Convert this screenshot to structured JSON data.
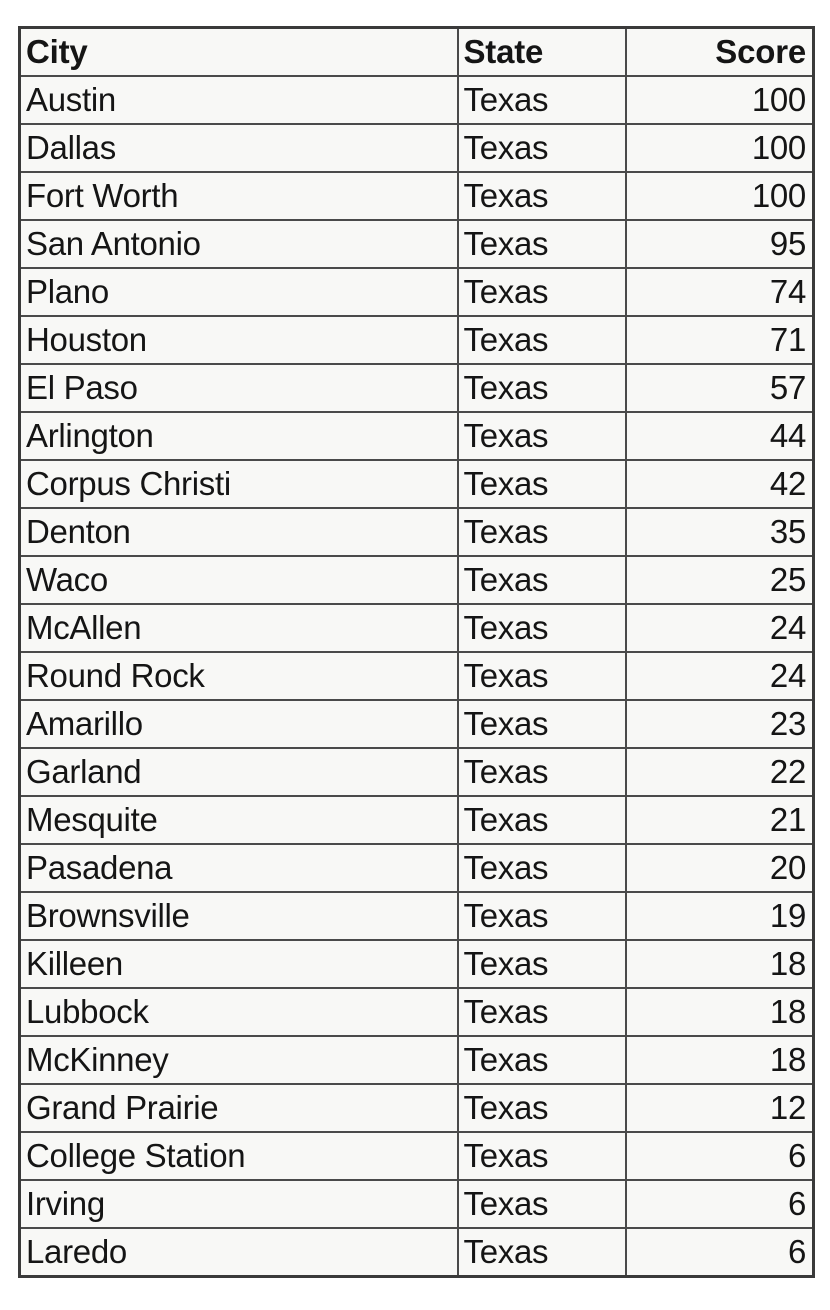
{
  "table": {
    "columns": [
      {
        "key": "city",
        "label": "City",
        "align": "left"
      },
      {
        "key": "state",
        "label": "State",
        "align": "left"
      },
      {
        "key": "score",
        "label": "Score",
        "align": "right"
      }
    ],
    "rows": [
      {
        "city": "Austin",
        "state": "Texas",
        "score": "100"
      },
      {
        "city": "Dallas",
        "state": "Texas",
        "score": "100"
      },
      {
        "city": "Fort Worth",
        "state": "Texas",
        "score": "100"
      },
      {
        "city": "San Antonio",
        "state": "Texas",
        "score": "95"
      },
      {
        "city": "Plano",
        "state": "Texas",
        "score": "74"
      },
      {
        "city": "Houston",
        "state": "Texas",
        "score": "71"
      },
      {
        "city": "El Paso",
        "state": "Texas",
        "score": "57"
      },
      {
        "city": "Arlington",
        "state": "Texas",
        "score": "44"
      },
      {
        "city": "Corpus Christi",
        "state": "Texas",
        "score": "42"
      },
      {
        "city": "Denton",
        "state": "Texas",
        "score": "35"
      },
      {
        "city": "Waco",
        "state": "Texas",
        "score": "25"
      },
      {
        "city": "McAllen",
        "state": "Texas",
        "score": "24"
      },
      {
        "city": "Round Rock",
        "state": "Texas",
        "score": "24"
      },
      {
        "city": "Amarillo",
        "state": "Texas",
        "score": "23"
      },
      {
        "city": "Garland",
        "state": "Texas",
        "score": "22"
      },
      {
        "city": "Mesquite",
        "state": "Texas",
        "score": "21"
      },
      {
        "city": "Pasadena",
        "state": "Texas",
        "score": "20"
      },
      {
        "city": "Brownsville",
        "state": "Texas",
        "score": "19"
      },
      {
        "city": "Killeen",
        "state": "Texas",
        "score": "18"
      },
      {
        "city": "Lubbock",
        "state": "Texas",
        "score": "18"
      },
      {
        "city": "McKinney",
        "state": "Texas",
        "score": "18"
      },
      {
        "city": "Grand Prairie",
        "state": "Texas",
        "score": "12"
      },
      {
        "city": "College Station",
        "state": "Texas",
        "score": "6"
      },
      {
        "city": "Irving",
        "state": "Texas",
        "score": "6"
      },
      {
        "city": "Laredo",
        "state": "Texas",
        "score": "6"
      }
    ]
  },
  "chart_data": {
    "type": "table",
    "title": "",
    "columns": [
      "City",
      "State",
      "Score"
    ],
    "categories": [
      "Austin",
      "Dallas",
      "Fort Worth",
      "San Antonio",
      "Plano",
      "Houston",
      "El Paso",
      "Arlington",
      "Corpus Christi",
      "Denton",
      "Waco",
      "McAllen",
      "Round Rock",
      "Amarillo",
      "Garland",
      "Mesquite",
      "Pasadena",
      "Brownsville",
      "Killeen",
      "Lubbock",
      "McKinney",
      "Grand Prairie",
      "College Station",
      "Irving",
      "Laredo"
    ],
    "values": [
      100,
      100,
      100,
      95,
      74,
      71,
      57,
      44,
      42,
      35,
      25,
      24,
      24,
      23,
      22,
      21,
      20,
      19,
      18,
      18,
      18,
      12,
      6,
      6,
      6
    ],
    "state": [
      "Texas",
      "Texas",
      "Texas",
      "Texas",
      "Texas",
      "Texas",
      "Texas",
      "Texas",
      "Texas",
      "Texas",
      "Texas",
      "Texas",
      "Texas",
      "Texas",
      "Texas",
      "Texas",
      "Texas",
      "Texas",
      "Texas",
      "Texas",
      "Texas",
      "Texas",
      "Texas",
      "Texas",
      "Texas"
    ],
    "xlabel": "City",
    "ylabel": "Score",
    "ylim": [
      0,
      100
    ],
    "grid": true,
    "legend": "none"
  },
  "style": {
    "border_color": "#4a4a4a",
    "cell_background": "#f8f8f6",
    "text_color": "#151515"
  }
}
